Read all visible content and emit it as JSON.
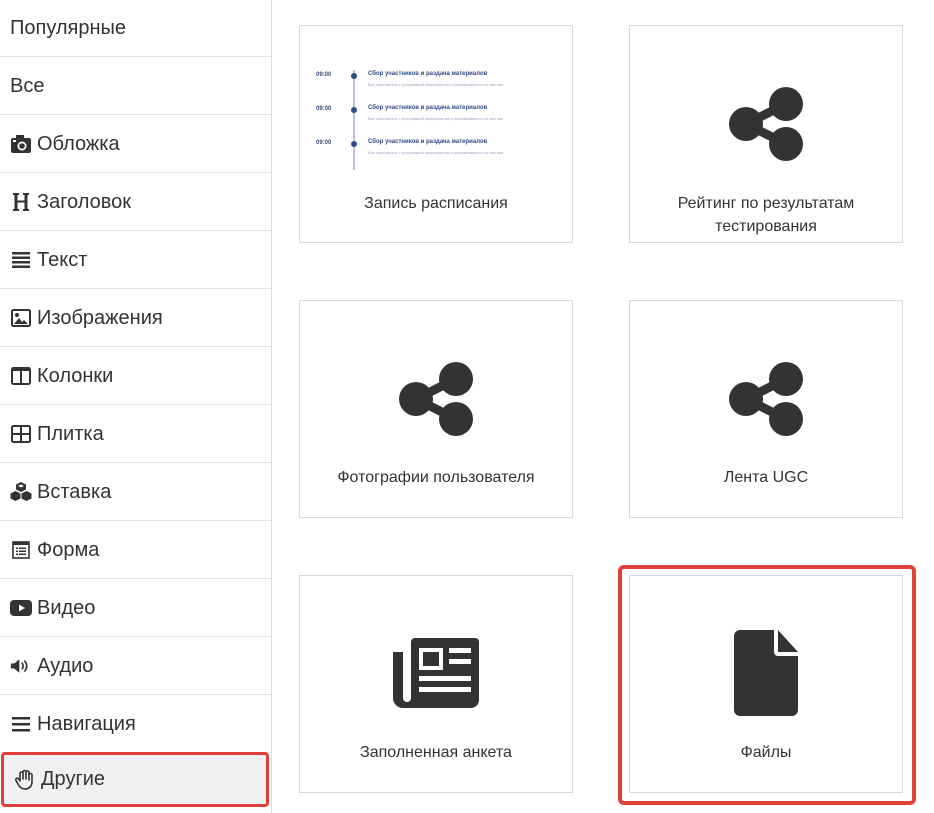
{
  "sidebar": {
    "items": [
      {
        "label": "Популярные",
        "icon": "none"
      },
      {
        "label": "Все",
        "icon": "none"
      },
      {
        "label": "Обложка",
        "icon": "camera-icon"
      },
      {
        "label": "Заголовок",
        "icon": "heading-icon"
      },
      {
        "label": "Текст",
        "icon": "text-lines-icon"
      },
      {
        "label": "Изображения",
        "icon": "image-icon"
      },
      {
        "label": "Колонки",
        "icon": "columns-icon"
      },
      {
        "label": "Плитка",
        "icon": "grid-icon"
      },
      {
        "label": "Вставка",
        "icon": "cubes-icon"
      },
      {
        "label": "Форма",
        "icon": "form-icon"
      },
      {
        "label": "Видео",
        "icon": "youtube-icon"
      },
      {
        "label": "Аудио",
        "icon": "volume-icon"
      },
      {
        "label": "Навигация",
        "icon": "menu-icon"
      },
      {
        "label": "Другие",
        "icon": "hand-icon",
        "active": true
      }
    ]
  },
  "cards": [
    {
      "label": "Запись расписания",
      "icon": "schedule-preview"
    },
    {
      "label": "Рейтинг по результатам тестирования",
      "icon": "share-icon"
    },
    {
      "label": "Фотографии пользователя",
      "icon": "share-icon"
    },
    {
      "label": "Лента UGC",
      "icon": "share-icon"
    },
    {
      "label": "Заполненная анкета",
      "icon": "newspaper-icon"
    },
    {
      "label": "Файлы",
      "icon": "file-icon",
      "highlighted": true
    }
  ],
  "schedule_preview": {
    "rows": [
      {
        "time": "09:00",
        "title": "Сбор участников и раздача материалов",
        "desc": "Все знакомятся с программой мероприятия и рассаживаются по местам"
      },
      {
        "time": "09:00",
        "title": "Сбор участников и раздача материалов",
        "desc": "Все знакомятся с программой мероприятия и рассаживаются по местам"
      },
      {
        "time": "09:00",
        "title": "Сбор участников и раздача материалов",
        "desc": "Все знакомятся с программой мероприятия и рассаживаются по местам"
      }
    ]
  },
  "colors": {
    "accent_red": "#e0403a",
    "icon_dark": "#333333",
    "schedule_blue": "#2f4a86"
  }
}
